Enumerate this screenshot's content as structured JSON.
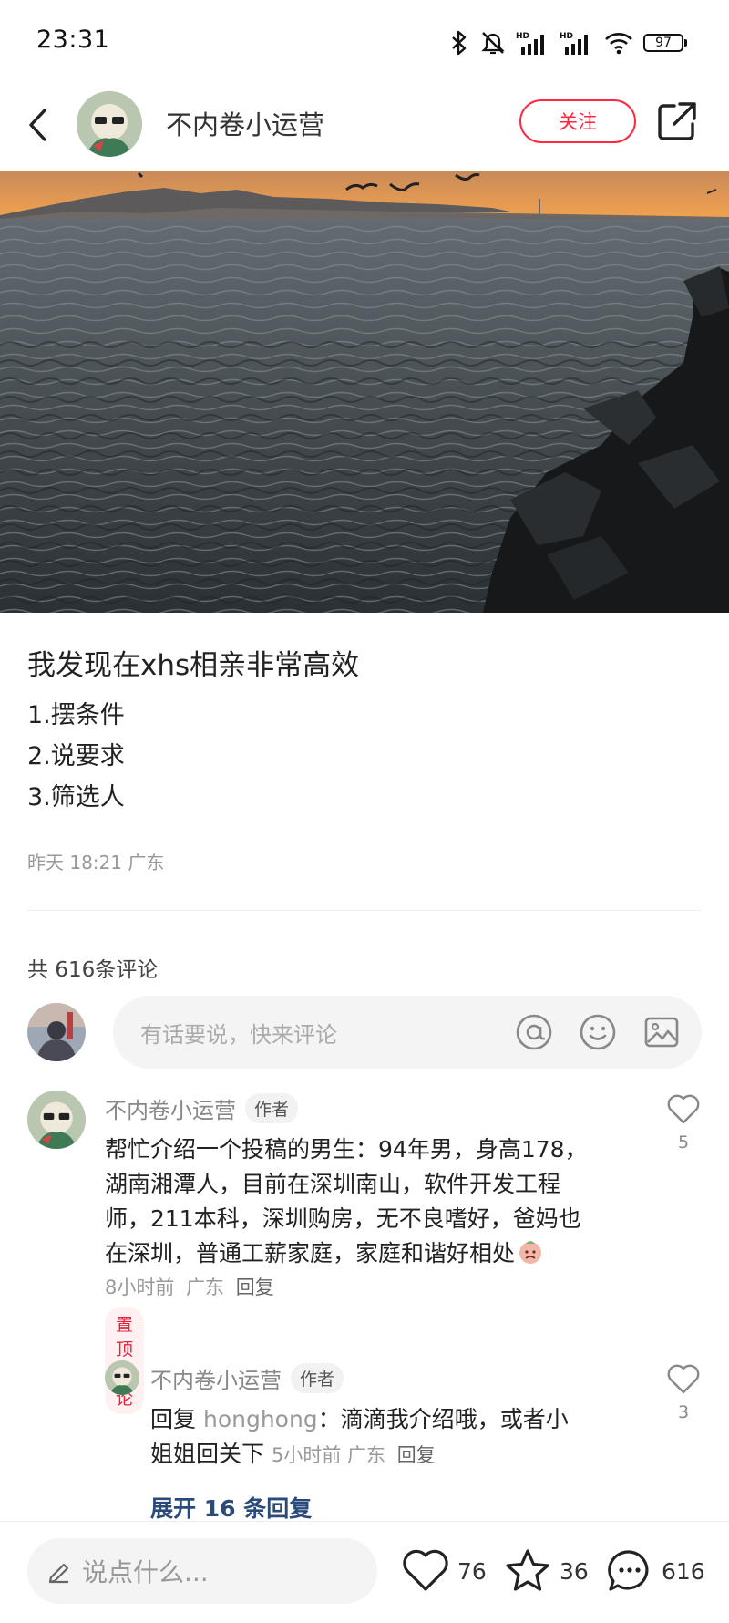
{
  "status_bar": {
    "time": "23:31",
    "battery": "97",
    "signal_label": "HD"
  },
  "header": {
    "author_name": "不内卷小运营",
    "follow_label": "关注"
  },
  "post": {
    "title": "我发现在xhs相亲非常高效",
    "lines": [
      "1.摆条件",
      "2.说要求",
      "3.筛选人"
    ],
    "meta": "昨天 18:21 广东"
  },
  "comments_section": {
    "count_label": "共 616条评论",
    "input_placeholder": "有话要说，快来评论"
  },
  "comments": [
    {
      "author": "不内卷小运营",
      "tag": "作者",
      "text_lines": [
        "帮忙介绍一个投稿的男生：94年男，身高178，",
        "湖南湘潭人，目前在深圳南山，软件开发工程",
        "师，211本科，深圳购房，无不良嗜好，爸妈也",
        "在深圳，普通工薪家庭，家庭和谐好相处"
      ],
      "time": "8小时前",
      "location": "广东",
      "reply_label": "回复",
      "pinned_label": "置顶评论",
      "likes": "5"
    }
  ],
  "reply": {
    "author": "不内卷小运营",
    "tag": "作者",
    "prefix": "回复",
    "target": "honghong",
    "text_first": "：滴滴我介绍哦，或者小",
    "text_second": "姐姐回关下",
    "time": "5小时前",
    "location": "广东",
    "reply_label": "回复",
    "likes": "3"
  },
  "expand_label": "展开 16 条回复",
  "bottom_bar": {
    "input_placeholder": "说点什么...",
    "likes": "76",
    "stars": "36",
    "comments": "616"
  }
}
